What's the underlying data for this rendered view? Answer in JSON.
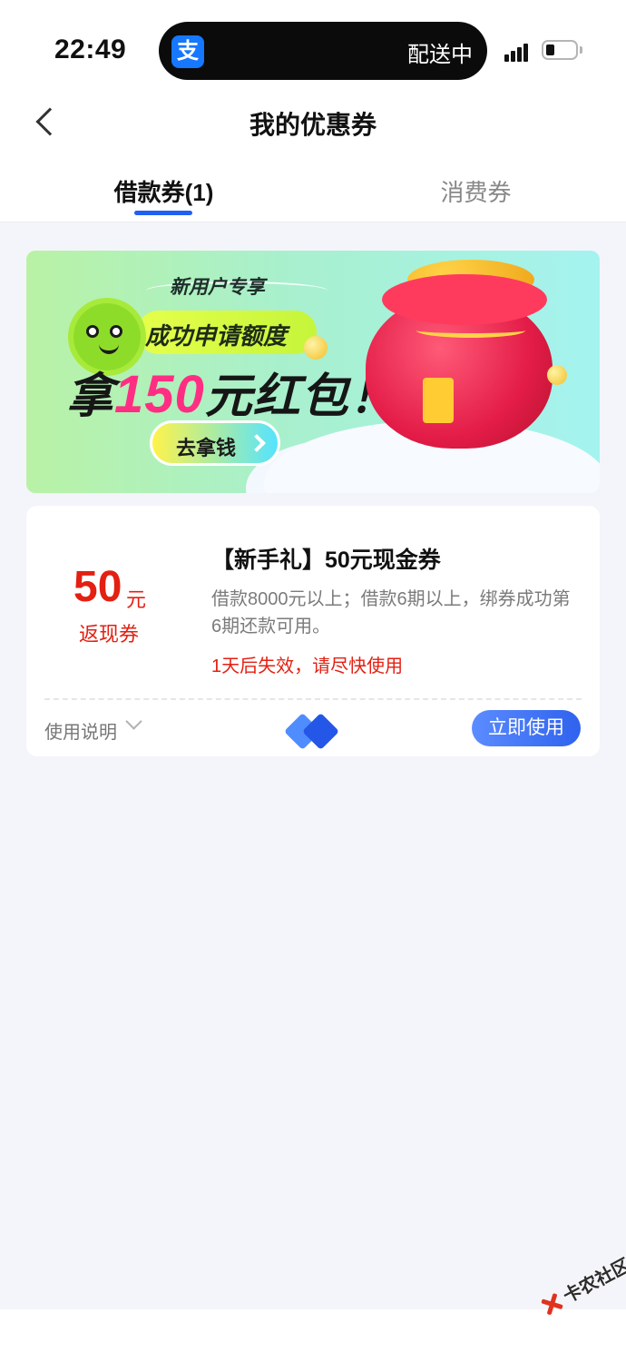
{
  "status_bar": {
    "time": "22:49",
    "app_icon_glyph": "支",
    "live_activity": "配送中",
    "icons": [
      "signal-icon",
      "battery-icon"
    ]
  },
  "nav": {
    "back_icon": "chevron-left-icon",
    "title": "我的优惠券"
  },
  "tabs": [
    {
      "label": "借款券(1)",
      "active": true
    },
    {
      "label": "消费券",
      "active": false
    }
  ],
  "banner": {
    "tag": "新用户专享",
    "line1": "成功申请额度",
    "line2_prefix": "拿",
    "line2_amount": "150",
    "line2_suffix": "元红包！",
    "button": "去拿钱"
  },
  "coupon": {
    "amount": "50",
    "unit": "元",
    "type": "返现券",
    "title": "【新手礼】50元现金券",
    "description": "借款8000元以上；借款6期以上，绑券成功第6期还款可用。",
    "expiry": "1天后失效，请尽快使用",
    "usage_label": "使用说明",
    "use_button": "立即使用"
  },
  "watermark": {
    "text": "卡农社区"
  },
  "colors": {
    "accent_blue": "#2f62ee",
    "coupon_red": "#e32012",
    "page_bg": "#f4f5fa"
  }
}
